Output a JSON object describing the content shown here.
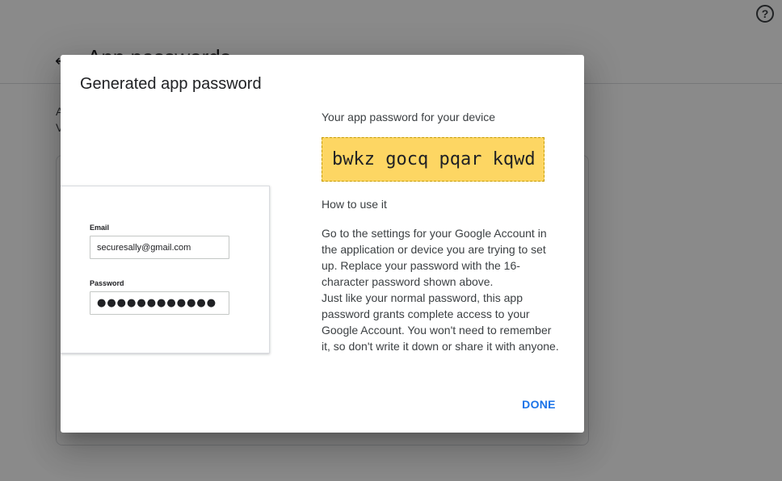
{
  "background": {
    "help_icon_glyph": "?",
    "back_icon_glyph": "←",
    "title": "App passwords",
    "text_line_1": "A",
    "text_line_2": "V"
  },
  "dialog": {
    "title": "Generated app password",
    "illustration": {
      "email_label": "Email",
      "email_value": "securesally@gmail.com",
      "password_label": "Password",
      "password_value": "●●●●●●●●●●●●"
    },
    "device_caption": "Your app password for your device",
    "app_password": "bwkz gocq pqar kqwd",
    "howto_title": "How to use it",
    "howto_paragraph_1": "Go to the settings for your Google Account in the application or device you are trying to set up. Replace your password with the 16-character password shown above.",
    "howto_paragraph_2": "Just like your normal password, this app password grants complete access to your Google Account. You won't need to remember it, so don't write it down or share it with anyone.",
    "done_label": "DONE"
  },
  "colors": {
    "scrim": "#000000",
    "password_highlight": "#fdd663",
    "accent": "#1a73e8"
  }
}
